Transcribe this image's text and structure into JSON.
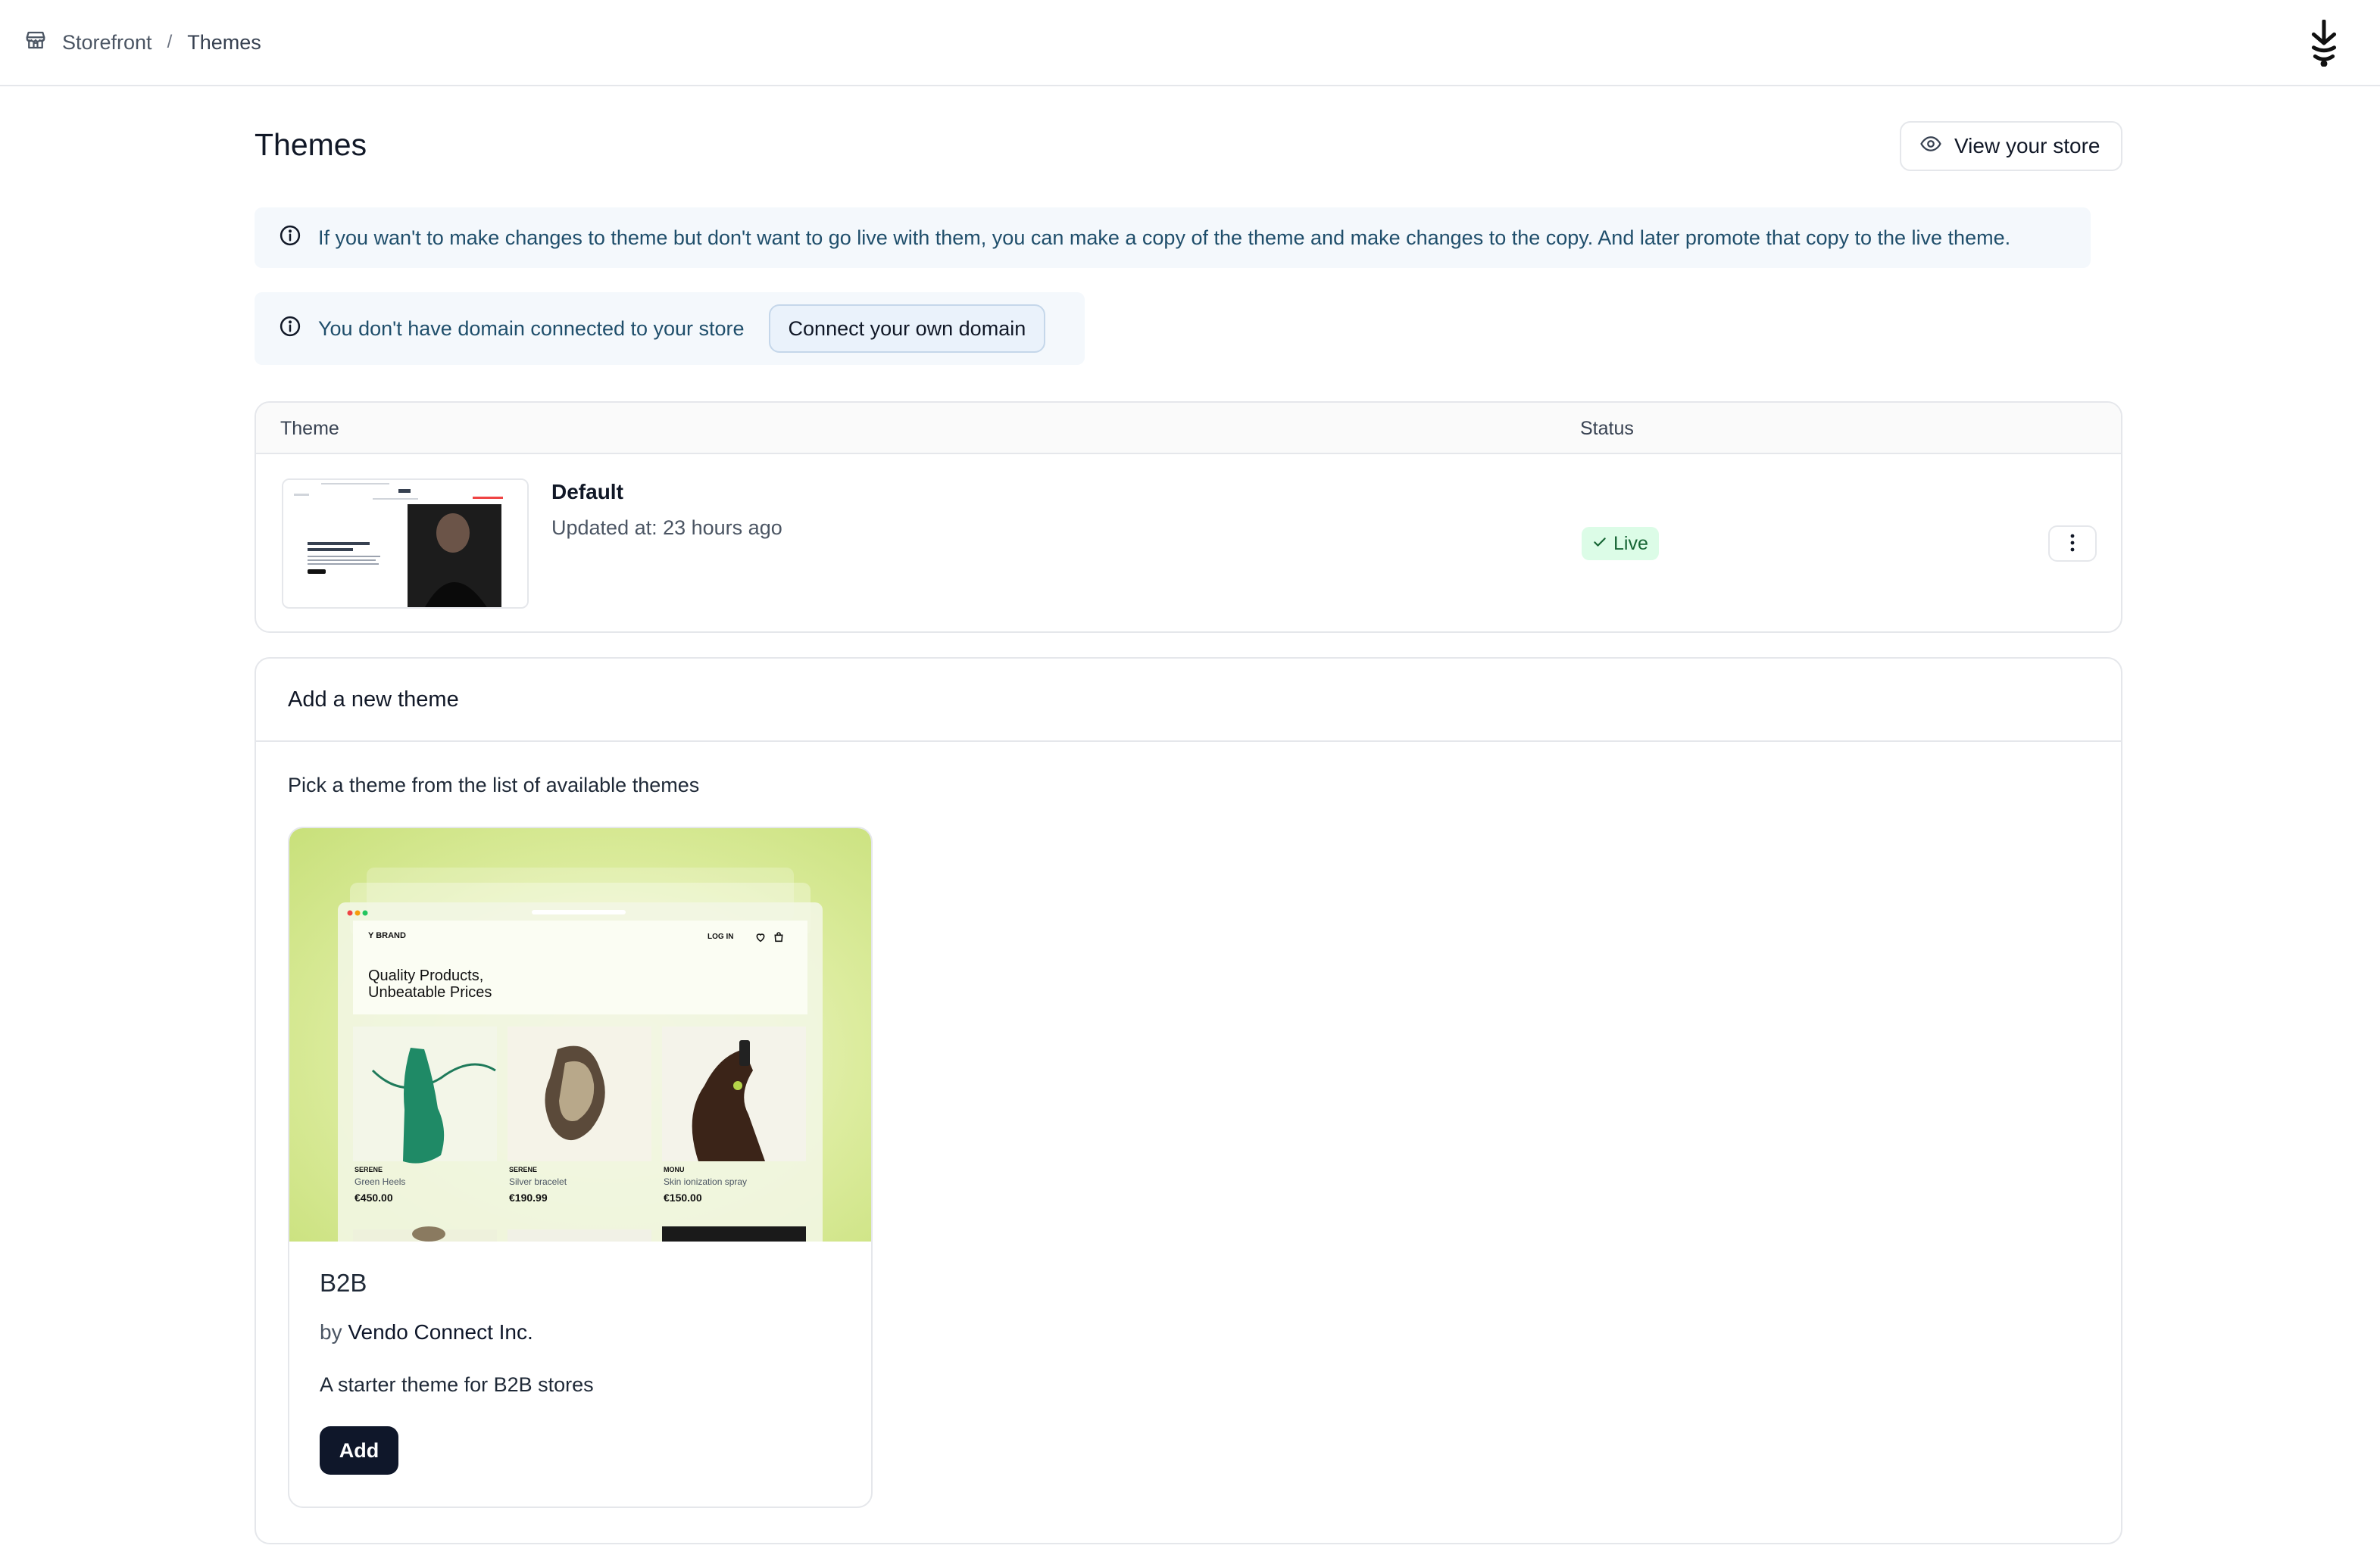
{
  "breadcrumb": {
    "items": [
      "Storefront",
      "Themes"
    ],
    "separator": "/"
  },
  "header": {
    "title": "Themes",
    "view_store_label": "View your store"
  },
  "notices": {
    "copy_theme": "If you wan't to make changes to theme but don't want to go live with them, you can make a copy of the theme and make changes to the copy. And later promote that copy to the live theme.",
    "domain": "You don't have domain connected to your store",
    "connect_domain_label": "Connect your own domain"
  },
  "themes_table": {
    "columns": [
      "Theme",
      "Status"
    ],
    "rows": [
      {
        "name": "Default",
        "updated": "Updated at: 23 hours ago",
        "status": "Live"
      }
    ]
  },
  "add_theme": {
    "heading": "Add a new theme",
    "subtitle": "Pick a theme from the list of available themes",
    "cards": [
      {
        "name": "B2B",
        "by_label": "by",
        "author": "Vendo Connect Inc.",
        "description": "A starter theme for B2B stores",
        "add_label": "Add",
        "preview": {
          "brand": "Y BRAND",
          "login": "LOG IN",
          "headline_1": "Quality Products,",
          "headline_2": "Unbeatable Prices",
          "products": [
            {
              "brand": "SERENE",
              "name": "Green Heels",
              "price": "€450.00"
            },
            {
              "brand": "SERENE",
              "name": "Silver bracelet",
              "price": "€190.99"
            },
            {
              "brand": "MONU",
              "name": "Skin ionization spray",
              "price": "€150.00"
            }
          ]
        }
      }
    ]
  },
  "colors": {
    "accent_dark": "#0f172a",
    "live_badge_bg": "#dcfce7",
    "live_badge_text": "#166534",
    "notice_bg": "#f4f8fc"
  },
  "icons": [
    "store-icon",
    "logo-icon",
    "eye-icon",
    "info-icon",
    "check-icon",
    "more-vertical-icon",
    "heart-icon",
    "bag-icon"
  ]
}
